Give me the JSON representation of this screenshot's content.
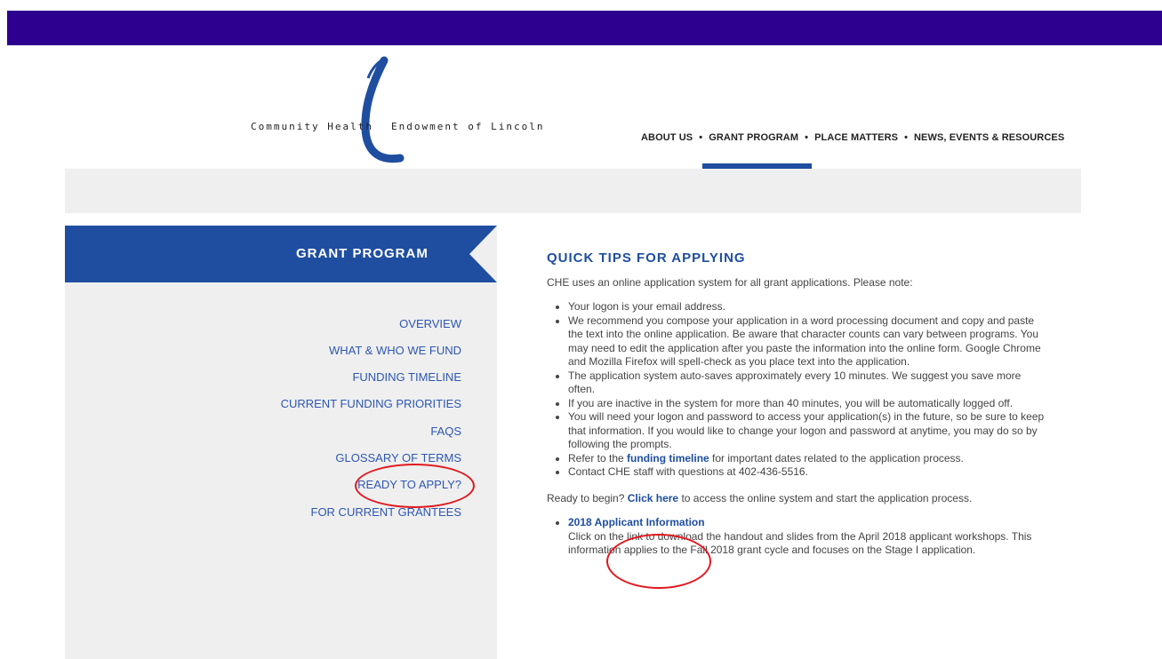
{
  "brand": {
    "left_text": "Community Health",
    "right_text": "Endowment of Lincoln",
    "color": "#1f4ea0"
  },
  "nav": {
    "items": [
      "ABOUT US",
      "GRANT PROGRAM",
      "PLACE MATTERS",
      "NEWS, EVENTS & RESOURCES"
    ],
    "separator": "•",
    "active": "GRANT PROGRAM"
  },
  "sidebar": {
    "title": "GRANT PROGRAM",
    "links": [
      "OVERVIEW",
      "WHAT & WHO WE FUND",
      "FUNDING TIMELINE",
      "CURRENT FUNDING PRIORITIES",
      "FAQS",
      "GLOSSARY OF TERMS",
      "READY TO APPLY?",
      "FOR CURRENT GRANTEES"
    ]
  },
  "content": {
    "title": "QUICK TIPS FOR APPLYING",
    "intro": "CHE uses an online application system for all grant applications. Please note:",
    "tips": {
      "t1": "Your logon is your email address.",
      "t2": "We recommend you compose your application in a word processing document and copy and paste the text into the online application. Be aware that character counts can vary between programs. You may need to edit the application after you paste the information into the online form. Google Chrome and Mozilla Firefox will spell-check as you place text into the application.",
      "t3": "The application system auto-saves approximately every 10 minutes. We suggest you save more often.",
      "t4": "If you are inactive in the system for more than 40 minutes, you will be automatically logged off.",
      "t5": "You will need your logon and password to access your application(s) in the future, so be sure to keep that information. If you would like to change your logon and password at anytime, you may do so by following the prompts.",
      "t6_before": "Refer to the ",
      "t6_link": "funding timeline",
      "t6_after": " for important dates related to the application process.",
      "t7": "Contact CHE staff with questions at 402-436-5516."
    },
    "ready": {
      "before": "Ready to begin? ",
      "link": "Click here",
      "after": " to access the online system and start the application process."
    },
    "applicant": {
      "link": "2018 Applicant Information",
      "text": "Click on the link to download the handout and slides from the April 2018 applicant workshops. This information applies to the Fall 2018 grant cycle and focuses on the Stage I application."
    }
  },
  "colors": {
    "topbar": "#2e0090",
    "accent": "#1f4ea0",
    "link": "#2d57b2",
    "highlight_circle": "#e0191e",
    "panel": "#efefef"
  }
}
